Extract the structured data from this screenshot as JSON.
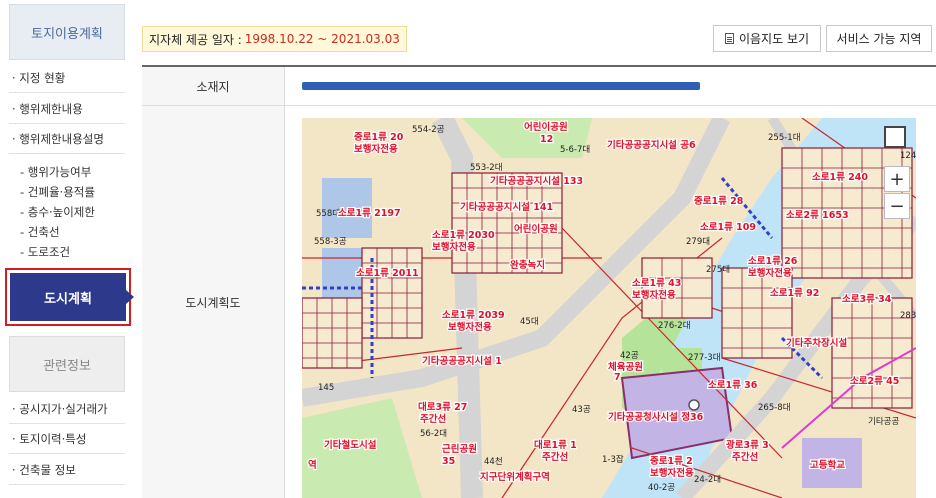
{
  "sidebar": {
    "header": "토지이용계획",
    "items": [
      {
        "label": "· 지정 현황"
      },
      {
        "label": "· 행위제한내용"
      },
      {
        "label": "· 행위제한내용설명"
      }
    ],
    "subitems": [
      {
        "label": "- 행위가능여부"
      },
      {
        "label": "- 건폐율·용적률"
      },
      {
        "label": "- 층수·높이제한"
      },
      {
        "label": "- 건축선"
      },
      {
        "label": "- 도로조건"
      }
    ],
    "active_item": "도시계획",
    "related_header": "관련정보",
    "related_items": [
      {
        "label": "· 공시지가·실거래가"
      },
      {
        "label": "· 토지이력·특성"
      },
      {
        "label": "· 건축물 정보"
      }
    ]
  },
  "provide_date": {
    "label": "지자체 제공 일자 :",
    "value": "1998.10.22 ~ 2021.03.03"
  },
  "buttons": {
    "view_map": "이음지도 보기",
    "service_area": "서비스 가능 지역"
  },
  "table": {
    "address_header": "소재지",
    "plan_header": "도시계획도"
  },
  "map": {
    "zoom_in": "+",
    "zoom_out": "−",
    "labels": [
      "중로1류 20",
      "보행자전용",
      "554-2공",
      "어린이공원",
      "12",
      "5-6-7대",
      "255-1대",
      "124",
      "기타공공공지시설 공6",
      "553-2대",
      "기타공공공지시설 133",
      "소로1류 240",
      "558대",
      "소로1류 2197",
      "기타공공공지시설 141",
      "중로1류 28",
      "소로1류 109",
      "소로2류 1653",
      "558-3공",
      "소로1류 2030",
      "보행자전용",
      "어린이공원",
      "279대",
      "소로1류 26",
      "보행자전용",
      "275대",
      "소로1류 2011",
      "완충녹지",
      "소로1류 43",
      "보행자전용",
      "소로1류 92",
      "소로3류 34",
      "소로1류 2039",
      "보행자전용",
      "45대",
      "276-2대",
      "기타주차장시설",
      "283",
      "42공",
      "체육공원",
      "7",
      "277-3대",
      "소로1류 36",
      "소로2류 45",
      "기타공공공지시설 1",
      "145",
      "대로3류 27",
      "주간선",
      "43공",
      "기타공공청사시설 정36",
      "265-8대",
      "기타공공",
      "기타철도시설",
      "56-2대",
      "대로1류 1",
      "주간선",
      "근린공원",
      "35",
      "1-3잡",
      "중로1류 2",
      "보행자전용",
      "광로3류 3",
      "주간선",
      "44천",
      "지구단위계획구역",
      "고등학교",
      "24-2대",
      "40-2공",
      "역"
    ]
  }
}
